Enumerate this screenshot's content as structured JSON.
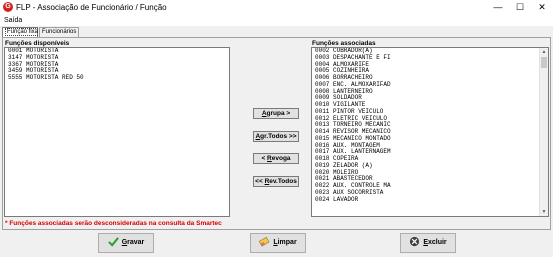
{
  "window": {
    "title": "FLP - Associação de Funcionário / Função",
    "app_icon_letter": "G",
    "minimize_glyph": "—",
    "maximize_glyph": "☐",
    "close_glyph": "✕"
  },
  "menu": {
    "items": [
      "Saída"
    ]
  },
  "tabs": [
    {
      "label": "Função fixa",
      "active": true
    },
    {
      "label": "Funcionários",
      "active": false
    }
  ],
  "available": {
    "label": "Funções disponíveis",
    "items": [
      "0001 MOTORISTA",
      "3147 MOTORISTA",
      "3367 MOTORISTA",
      "3459 MOTORISTA",
      "5555 MOTORISTA RED 50"
    ]
  },
  "associated": {
    "label": "Funções associadas",
    "items": [
      "0002 COBRADOR(A)",
      "0003 DESPACHANTE E FI",
      "0004 ALMOXARIFE",
      "0005 COZINHEIRA",
      "0006 BORRACHEIRO",
      "0007 ENC. ALMOXARIFAD",
      "0008 LANTERNEIRO",
      "0009 SOLDADOR",
      "0010 VIGILANTE",
      "0011 PINTOR VEICULO",
      "0012 ELETRIC VEICULO",
      "0013 TORNEIRO MECANIC",
      "0014 REVISOR MECANICO",
      "0015 MECANICO MONTADO",
      "0016 AUX. MONTAGEM",
      "0017 AUX. LANTERNAGEM",
      "0018 COPEIRA",
      "0019 ZELADOR (A)",
      "0020 MOLEIRO",
      "0021 ABASTECEDOR",
      "0022 AUX. CONTROLE MA",
      "0023 AUX SOCORRISTA",
      "0024 LAVADOR"
    ]
  },
  "actions": {
    "agrupa": {
      "first": "A",
      "rest": "grupa >"
    },
    "agr_todos": {
      "first": "A",
      "rest": "gr.Todos >>"
    },
    "revoga": {
      "first": "< ",
      "underline": "R",
      "rest": "evoga"
    },
    "rev_todos": {
      "first": "<< ",
      "underline": "R",
      "rest": "ev.Todos"
    }
  },
  "note": "* Funções associadas serão desconsideradas na consulta da Smartec",
  "buttons": {
    "gravar": {
      "underline": "G",
      "rest": "ravar"
    },
    "limpar": {
      "underline": "L",
      "rest": "impar"
    },
    "excluir": {
      "underline": "E",
      "rest": "xcluir"
    }
  },
  "colors": {
    "note_red": "#d40000",
    "app_icon_red": "#d32323",
    "check_green": "#2a9d2a"
  }
}
